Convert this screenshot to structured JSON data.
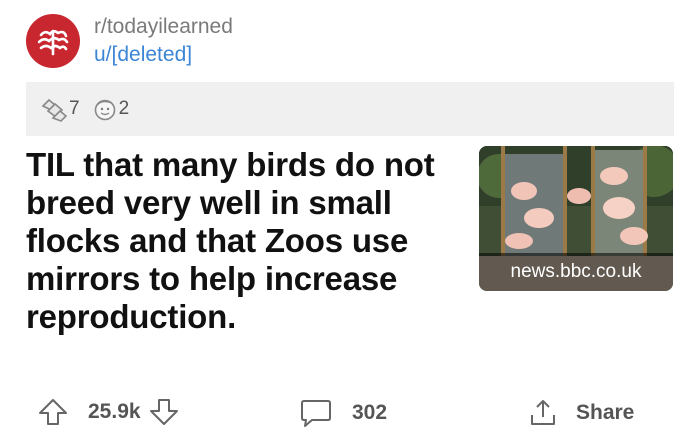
{
  "post": {
    "subreddit": "r/todayilearned",
    "author": "u/[deleted]",
    "awards": [
      {
        "icon": "gold-hands-award-icon",
        "count": "7"
      },
      {
        "icon": "face-award-icon",
        "count": "2"
      }
    ],
    "title": "TIL that many birds do not breed very well in small flocks and that Zoos use mirrors to help increase reproduction.",
    "link_domain": "news.bbc.co.uk",
    "thumbnail": "flamingos-with-mirrors-image"
  },
  "actions": {
    "upvotes": "25.9k",
    "comments": "302",
    "share_label": "Share"
  },
  "colors": {
    "subreddit_avatar": "#c8272f",
    "author_link": "#3b86d6",
    "award_bar": "#f0f0f0",
    "action_text": "#555555"
  }
}
